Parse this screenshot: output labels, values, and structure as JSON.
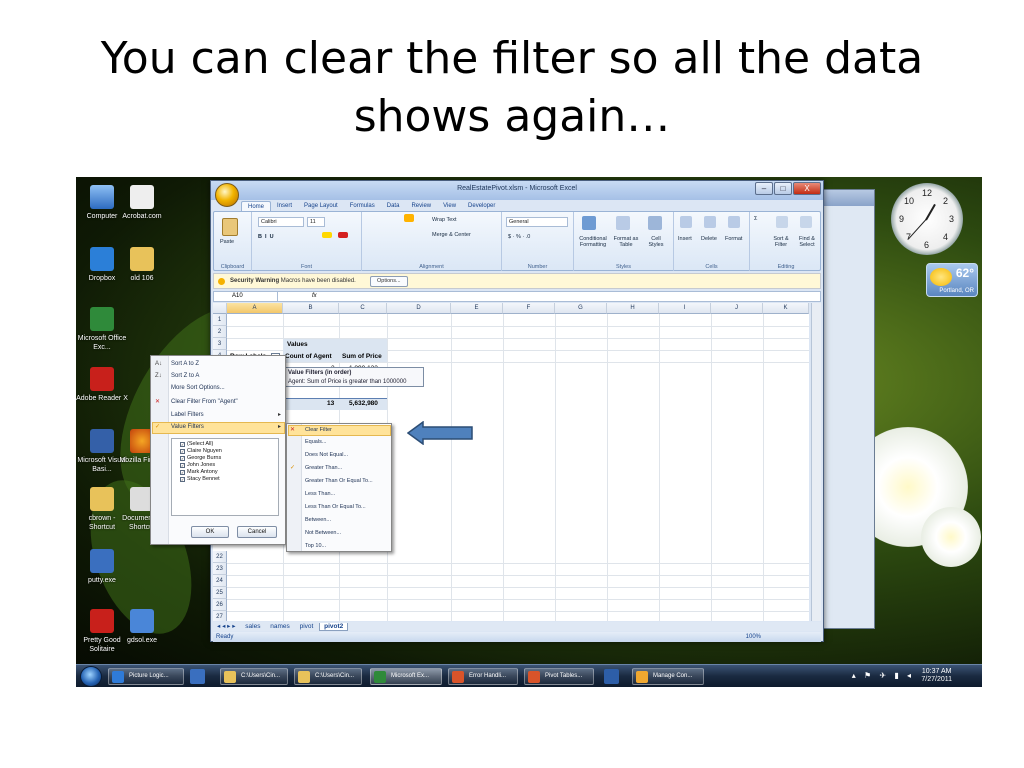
{
  "slide": {
    "title_line1": "You can clear the filter so all the data",
    "title_line2": "shows again…"
  },
  "desktop": {
    "icons": [
      {
        "label": "Computer",
        "color": "#4a86d8"
      },
      {
        "label": "Acrobat.com",
        "color": "#d9d9d9"
      },
      {
        "label": "Dropbox",
        "color": "#2b7fd8"
      },
      {
        "label": "old 106",
        "color": "#e8c25a"
      },
      {
        "label": "Microsoft Office Exc...",
        "color": "#2f8a3a"
      },
      {
        "label": "Adobe Reader X",
        "color": "#c8201b"
      },
      {
        "label": "Microsoft Visual Basi...",
        "color": "#3460a8"
      },
      {
        "label": "Mozilla Firefox",
        "color": "#e66a1a"
      },
      {
        "label": "cbrown - Shortcut",
        "color": "#e8c25a"
      },
      {
        "label": "Documents - Shortcut",
        "color": "#d9d9d9"
      },
      {
        "label": "putty.exe",
        "color": "#3a6fbf"
      },
      {
        "label": "Pretty Good Solitaire",
        "color": "#c8201b"
      },
      {
        "label": "gdsol.exe",
        "color": "#4a86d8"
      }
    ],
    "clock_numbers": [
      "12",
      "1",
      "2",
      "3",
      "4",
      "5",
      "6",
      "7",
      "8",
      "9",
      "10",
      "11"
    ],
    "weather": {
      "temp": "62°",
      "city": "Portland, OR"
    }
  },
  "excel": {
    "title": "RealEstatePivot.xlsm - Microsoft Excel",
    "window_buttons": {
      "min": "–",
      "max": "□",
      "close": "X"
    },
    "tabs": [
      "Home",
      "Insert",
      "Page Layout",
      "Formulas",
      "Data",
      "Review",
      "View",
      "Developer"
    ],
    "ribbon": {
      "paste": "Paste",
      "font_name": "Calibri",
      "font_size": "11",
      "wrap_text": "Wrap Text",
      "merge_center": "Merge & Center",
      "number_format": "General",
      "conditional_formatting": "Conditional Formatting",
      "format_as_table": "Format as Table",
      "cell_styles": "Cell Styles",
      "insert": "Insert",
      "delete": "Delete",
      "format": "Format",
      "sort_filter": "Sort & Filter",
      "find_select": "Find & Select",
      "groups": [
        "Clipboard",
        "Font",
        "Alignment",
        "Number",
        "Styles",
        "Cells",
        "Editing"
      ]
    },
    "security_bar": {
      "title": "Security Warning",
      "message": "Macros have been disabled.",
      "options_button": "Options..."
    },
    "formula_bar": {
      "name_box": "A10",
      "fx": "fx"
    },
    "columns": [
      "A",
      "B",
      "C",
      "D",
      "E",
      "F",
      "G",
      "H",
      "I",
      "J",
      "K"
    ],
    "row_numbers_top": [
      "1",
      "2",
      "3",
      "4"
    ],
    "row_numbers_bottom": [
      "22",
      "23",
      "24",
      "25",
      "26",
      "27"
    ],
    "cells": {
      "b3": "Values",
      "a4": "Row Labels",
      "b4": "Count of Agent",
      "c4": "Sum of Price",
      "b5": "3",
      "c5": "1,890,122",
      "b9": "13",
      "c9": "5,632,980"
    },
    "tooltip": {
      "title": "Value Filters (in order)",
      "text": "Agent: Sum of Price is greater than 1000000"
    },
    "sort_menu": [
      {
        "icon": "A↓",
        "label": "Sort A to Z"
      },
      {
        "icon": "Z↓",
        "label": "Sort Z to A"
      },
      {
        "icon": "",
        "label": "More Sort Options..."
      },
      {
        "icon": "✕",
        "label": "Clear Filter From \"Agent\""
      },
      {
        "icon": "",
        "label": "Label Filters"
      },
      {
        "icon": "✓",
        "label": "Value Filters"
      }
    ],
    "checklist": [
      "(Select All)",
      "Claire Nguyen",
      "George Burns",
      "John Jones",
      "Mark Antony",
      "Stacy Bennet"
    ],
    "ok_button": "OK",
    "cancel_button": "Cancel",
    "value_filters_submenu": [
      "Clear Filter",
      "Equals...",
      "Does Not Equal...",
      "Greater Than...",
      "Greater Than Or Equal To...",
      "Less Than...",
      "Less Than Or Equal To...",
      "Between...",
      "Not Between...",
      "Top 10..."
    ],
    "sheet_tabs": [
      "sales",
      "names",
      "pivot",
      "pivot2"
    ],
    "active_sheet": "pivot2",
    "status": {
      "ready": "Ready",
      "zoom": "100%"
    }
  },
  "taskbar": {
    "buttons": [
      "Picture Logic...",
      "C:\\Users\\Cin...",
      "C:\\Users\\Cin...",
      "Microsoft Ex...",
      "Error Handli...",
      "Pivot Tables...",
      "Manage Con..."
    ],
    "time": "10:37 AM",
    "date": "7/27/2011"
  }
}
